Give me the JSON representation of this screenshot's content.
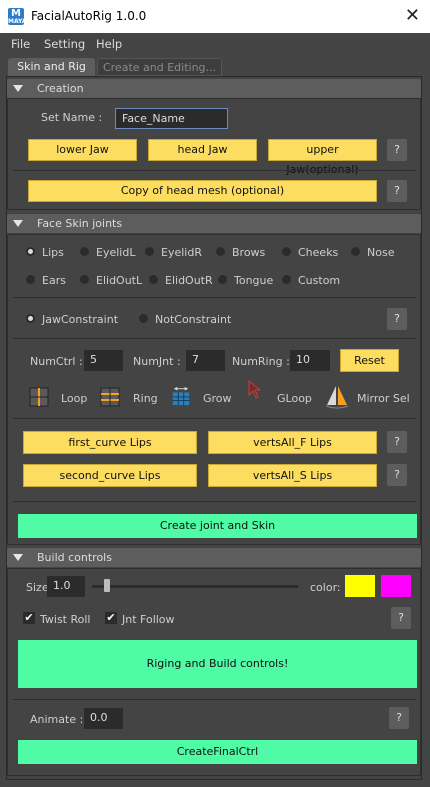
{
  "window": {
    "title": "FacialAutoRig 1.0.0",
    "icon_letter": "M",
    "icon_sub": "MAYA",
    "close_glyph": "✕"
  },
  "menu": {
    "items": [
      "File",
      "Setting",
      "Help"
    ]
  },
  "tabs": {
    "active": "Skin and Rig",
    "inactive": "Create and Editing..."
  },
  "creation": {
    "title": "Creation",
    "set_name_label": "Set Name :",
    "set_name_value": "Face_Name",
    "lower_jaw": "lower Jaw",
    "head_jaw": "head Jaw",
    "upper_jaw": "upper Jaw(optional)",
    "copy_head": "Copy of head mesh (optional)",
    "help": "?"
  },
  "skin": {
    "title": "Face Skin joints",
    "radios_row1": [
      "Lips",
      "EyelidL",
      "EyelidR",
      "Brows",
      "Cheeks",
      "Nose"
    ],
    "radios_row2": [
      "Ears",
      "ElidOutL",
      "ElidOutR",
      "Tongue",
      "Custom"
    ],
    "constraint_on": "JawConstraint",
    "constraint_off": "NotConstraint",
    "numctrl_label": "NumCtrl :",
    "numctrl_value": "5",
    "numjnt_label": "NumJnt :",
    "numjnt_value": "7",
    "numring_label": "NumRing :",
    "numring_value": "10",
    "reset": "Reset",
    "tools": [
      "Loop",
      "Ring",
      "Grow",
      "GLoop",
      "Mirror Sel"
    ],
    "first_curve": "first_curve Lips",
    "verts_f": "vertsAll_F Lips",
    "second_curve": "second_curve Lips",
    "verts_s": "vertsAll_S Lips",
    "create": "Create joint and Skin",
    "help": "?"
  },
  "build": {
    "title": "Build controls",
    "size_label": "Size",
    "size_value": "1.0",
    "size_slider_fraction": 0.06,
    "color_label": "color:",
    "color1": "#ffff00",
    "color2": "#ff00ff",
    "twist_roll": "Twist Roll",
    "jnt_follow": "Jnt Follow",
    "check_glyph": "✔",
    "riging": "Riging and Build controls!",
    "animate_label": "Animate :",
    "animate_value": "0.0",
    "final": "CreateFinalCtrl",
    "help": "?"
  },
  "colors": {
    "yellow": "#fddd5f",
    "green": "#4ffba5",
    "panel": "#444444",
    "header": "#5d5d5d"
  }
}
